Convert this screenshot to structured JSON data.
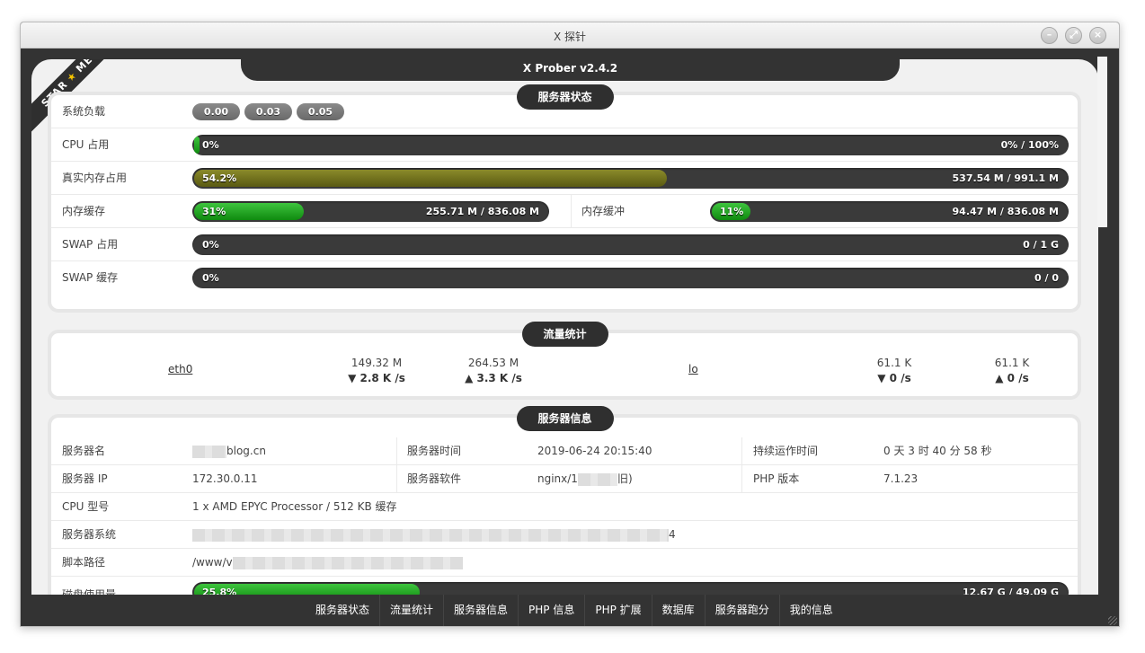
{
  "window": {
    "title": "X 探针"
  },
  "app": {
    "title": "X Prober v2.4.2",
    "ribbon_left": "STAR",
    "ribbon_star": "★",
    "ribbon_right": "ME"
  },
  "server_status": {
    "title": "服务器状态",
    "load": {
      "label": "系统负载",
      "values": [
        "0.00",
        "0.03",
        "0.05"
      ]
    },
    "cpu": {
      "label": "CPU 占用",
      "percent_text": "0%",
      "value_text": "0% / 100%",
      "percent": 0.5
    },
    "mem_real": {
      "label": "真实内存占用",
      "percent_text": "54.2%",
      "value_text": "537.54 M / 991.1 M",
      "percent": 54.2
    },
    "mem_cache": {
      "label": "内存缓存",
      "percent_text": "31%",
      "value_text": "255.71 M / 836.08 M",
      "percent": 31
    },
    "mem_buffer": {
      "label": "内存缓冲",
      "percent_text": "11%",
      "value_text": "94.47 M / 836.08 M",
      "percent": 11
    },
    "swap_used": {
      "label": "SWAP 占用",
      "percent_text": "0%",
      "value_text": "0 / 1 G",
      "percent": 0
    },
    "swap_cache": {
      "label": "SWAP 缓存",
      "percent_text": "0%",
      "value_text": "0 / 0",
      "percent": 0
    }
  },
  "network": {
    "title": "流量统计",
    "interfaces": [
      {
        "name": "eth0",
        "rx_total": "149.32 M",
        "rx_rate": "▼ 2.8 K /s",
        "tx_total": "264.53 M",
        "tx_rate": "▲ 3.3 K /s"
      },
      {
        "name": "lo",
        "rx_total": "61.1 K",
        "rx_rate": "▼ 0 /s",
        "tx_total": "61.1 K",
        "tx_rate": "▲ 0 /s"
      }
    ]
  },
  "server_info": {
    "title": "服务器信息",
    "server_name_label": "服务器名",
    "server_name_value": "blog.cn",
    "server_time_label": "服务器时间",
    "server_time_value": "2019-06-24 20:15:40",
    "uptime_label": "持续运作时间",
    "uptime_value": "0 天 3 时 40 分 58 秒",
    "server_ip_label": "服务器 IP",
    "server_ip_value": "172.30.0.11",
    "server_software_label": "服务器软件",
    "server_software_prefix": "nginx/1",
    "server_software_suffix": "旧)",
    "php_version_label": "PHP 版本",
    "php_version_value": "7.1.23",
    "cpu_model_label": "CPU 型号",
    "cpu_model_value": "1 x AMD EPYC Processor / 512 KB 缓存",
    "os_label": "服务器系统",
    "os_suffix": "4",
    "script_path_label": "脚本路径",
    "script_path_prefix": "/www/v",
    "disk": {
      "label": "磁盘使用量",
      "percent_text": "25.8%",
      "value_text": "12.67 G / 49.09 G",
      "percent": 25.8
    }
  },
  "bottom_nav": [
    "服务器状态",
    "流量统计",
    "服务器信息",
    "PHP 信息",
    "PHP 扩展",
    "数据库",
    "服务器跑分",
    "我的信息"
  ]
}
